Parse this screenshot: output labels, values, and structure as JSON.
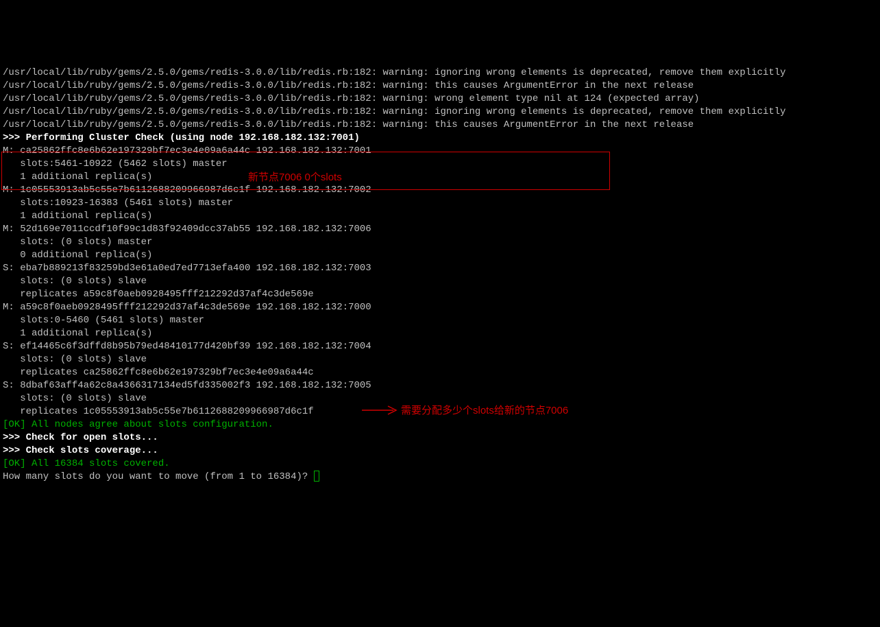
{
  "warnings": [
    "/usr/local/lib/ruby/gems/2.5.0/gems/redis-3.0.0/lib/redis.rb:182: warning: ignoring wrong elements is deprecated, remove them explicitly",
    "/usr/local/lib/ruby/gems/2.5.0/gems/redis-3.0.0/lib/redis.rb:182: warning: this causes ArgumentError in the next release",
    "/usr/local/lib/ruby/gems/2.5.0/gems/redis-3.0.0/lib/redis.rb:182: warning: wrong element type nil at 124 (expected array)",
    "/usr/local/lib/ruby/gems/2.5.0/gems/redis-3.0.0/lib/redis.rb:182: warning: ignoring wrong elements is deprecated, remove them explicitly",
    "/usr/local/lib/ruby/gems/2.5.0/gems/redis-3.0.0/lib/redis.rb:182: warning: this causes ArgumentError in the next release"
  ],
  "section_headers": {
    "cluster_check": ">>> Performing Cluster Check (using node 192.168.182.132:7001)",
    "open_slots": ">>> Check for open slots...",
    "slots_coverage": ">>> Check slots coverage..."
  },
  "nodes": [
    {
      "role": "M",
      "line1": "M: ca25862ffc8e6b62e197329bf7ec3e4e09a6a44c 192.168.182.132:7001",
      "line2": "   slots:5461-10922 (5462 slots) master",
      "line3": "   1 additional replica(s)"
    },
    {
      "role": "M",
      "line1": "M: 1c05553913ab5c55e7b6112688209966987d6c1f 192.168.182.132:7002",
      "line2": "   slots:10923-16383 (5461 slots) master",
      "line3": "   1 additional replica(s)"
    },
    {
      "role": "M",
      "line1": "M: 52d169e7011ccdf10f99c1d83f92409dcc37ab55 192.168.182.132:7006",
      "line2": "   slots: (0 slots) master",
      "line3": "   0 additional replica(s)"
    },
    {
      "role": "S",
      "line1": "S: eba7b889213f83259bd3e61a0ed7ed7713efa400 192.168.182.132:7003",
      "line2": "   slots: (0 slots) slave",
      "line3": "   replicates a59c8f0aeb0928495fff212292d37af4c3de569e"
    },
    {
      "role": "M",
      "line1": "M: a59c8f0aeb0928495fff212292d37af4c3de569e 192.168.182.132:7000",
      "line2": "   slots:0-5460 (5461 slots) master",
      "line3": "   1 additional replica(s)"
    },
    {
      "role": "S",
      "line1": "S: ef14465c6f3dffd8b95b79ed48410177d420bf39 192.168.182.132:7004",
      "line2": "   slots: (0 slots) slave",
      "line3": "   replicates ca25862ffc8e6b62e197329bf7ec3e4e09a6a44c"
    },
    {
      "role": "S",
      "line1": "S: 8dbaf63aff4a62c8a4366317134ed5fd335002f3 192.168.182.132:7005",
      "line2": "   slots: (0 slots) slave",
      "line3": "   replicates 1c05553913ab5c55e7b6112688209966987d6c1f"
    }
  ],
  "ok_messages": {
    "agree": "[OK] All nodes agree about slots configuration.",
    "covered": "[OK] All 16384 slots covered."
  },
  "prompt": "How many slots do you want to move (from 1 to 16384)? ",
  "annotations": {
    "new_node": "新节点7006 0个slots",
    "need_allocate": "需要分配多少个slots给新的节点7006"
  }
}
